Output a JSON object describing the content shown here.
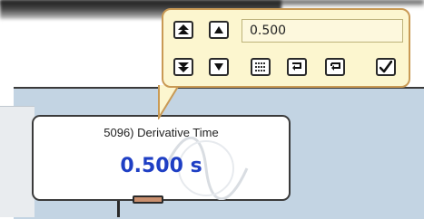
{
  "popover": {
    "value_input": "0.500",
    "buttons": {
      "increment_fast": "increment-fast-icon",
      "increment": "increment-icon",
      "decrement_fast": "decrement-fast-icon",
      "decrement": "decrement-icon",
      "keypad": "keypad-icon",
      "return_a": "return-icon",
      "return_b": "return-alt-icon",
      "confirm": "checkmark-icon"
    }
  },
  "card": {
    "title": "5096) Derivative Time",
    "value": "0.500 s"
  },
  "colors": {
    "canvas": "#c3d4e3",
    "popover_bg": "#fcf6cf",
    "popover_border": "#c99a55",
    "value_text": "#1f3fc4",
    "handle": "#c98f6e"
  }
}
